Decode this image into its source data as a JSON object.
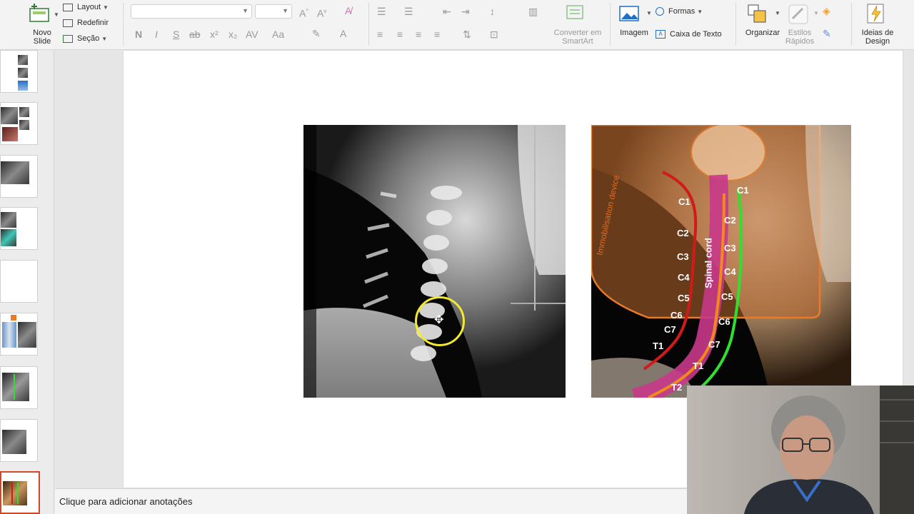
{
  "ribbon": {
    "new_slide_label": "Novo Slide",
    "layout_label": "Layout",
    "reset_label": "Redefinir",
    "section_label": "Seção",
    "font_buttons": [
      "N",
      "I",
      "S",
      "ab",
      "x²",
      "x₂"
    ],
    "convert_smartart_label": "Converter em SmartArt",
    "image_label": "Imagem",
    "shapes_label": "Formas",
    "textbox_label": "Caixa de Texto",
    "organize_label": "Organizar",
    "quick_styles_label": "Estilos Rápidos",
    "design_ideas_label": "Ideias de Design"
  },
  "notes": {
    "placeholder": "Clique para adicionar anotações"
  },
  "slide": {
    "annotated_xray": {
      "device_label": "Immobilisation device",
      "cord_label": "Spinal cord",
      "left_labels": [
        "C1",
        "C2",
        "C3",
        "C4",
        "C5",
        "C6",
        "C7",
        "T1"
      ],
      "right_labels": [
        "C1",
        "C2",
        "C3",
        "C4",
        "C5",
        "C6",
        "C7",
        "T1",
        "T2"
      ]
    }
  },
  "colors": {
    "accent": "#d24726",
    "red_line": "#d11a1a",
    "orange_line": "#f08a1c",
    "green_line": "#2fe02f",
    "cord": "#c8388a",
    "pointer": "#f2ea2a"
  }
}
